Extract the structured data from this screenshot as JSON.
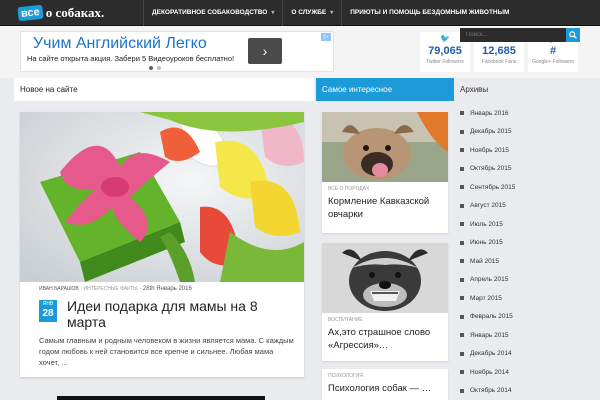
{
  "logo": {
    "badge": "все",
    "text": "о собаках."
  },
  "nav": {
    "items": [
      {
        "label": "ДЕКОРАТИВНОЕ СОБАКОВОДСТВО",
        "caret": "▾"
      },
      {
        "label": "О СЛУЖБЕ",
        "caret": "▾"
      },
      {
        "label": "ПРИЮТЫ И ПОМОЩЬ БЕЗДОМНЫМ ЖИВОТНЫМ",
        "caret": ""
      }
    ]
  },
  "ad": {
    "title": "Учим Английский Легко",
    "subtitle": "На сайте открыта акция. Забери 5 Видеоуроков бесплатно!",
    "button": "›",
    "info": "▷"
  },
  "social": [
    {
      "icon": "twitter-icon",
      "glyph": "🐦",
      "count": "79,065",
      "label": "Twitter Followers"
    },
    {
      "icon": "facebook-icon",
      "glyph": "f",
      "count": "12,685",
      "label": "Facebook Fans"
    },
    {
      "icon": "googleplus-icon",
      "glyph": "g+",
      "count": "#",
      "label": "Google+ Followers"
    }
  ],
  "search": {
    "placeholder": "Поиск...",
    "icon": "search-icon"
  },
  "sections": {
    "new": "Новое на сайте",
    "interesting": "Самое интересное",
    "archive": "Архивы"
  },
  "main_post": {
    "author": "ИВАН БАРАШОВ",
    "category": "ИНТЕРЕСНЫЕ ФАКТЫ",
    "date_text": "28th Январь 2016",
    "badge_month": "ЯНВ",
    "badge_day": "28",
    "title": "Идеи подарка для мамы на 8 марта",
    "excerpt": "Самым главным и родным человеком в жизни является мама. С каждым годом любовь к ней становится все крепче и сильнее. Любая мама хочет, ..."
  },
  "interesting": [
    {
      "category": "ВСЕ О ПОРОДАХ",
      "title": "Кормление Кавказской овчарки"
    },
    {
      "category": "ВОСПИТАНИЕ",
      "title": "Ах,это страшное слово «Агрессия»…"
    },
    {
      "category": "ПСИХОЛОГИЯ",
      "title": "Психология собак — …"
    }
  ],
  "archive": [
    "Январь 2016",
    "Декабрь 2015",
    "Ноябрь 2015",
    "Октябрь 2015",
    "Сентябрь 2015",
    "Август 2015",
    "Июль 2015",
    "Июнь 2015",
    "Май 2015",
    "Апрель 2015",
    "Март 2015",
    "Февраль 2015",
    "Январь 2015",
    "Декабрь 2014",
    "Ноябрь 2014",
    "Октябрь 2014"
  ],
  "colors": {
    "accent": "#1d9bd9",
    "topbar": "#2c2c2c",
    "page_bg": "#e9ebee"
  }
}
